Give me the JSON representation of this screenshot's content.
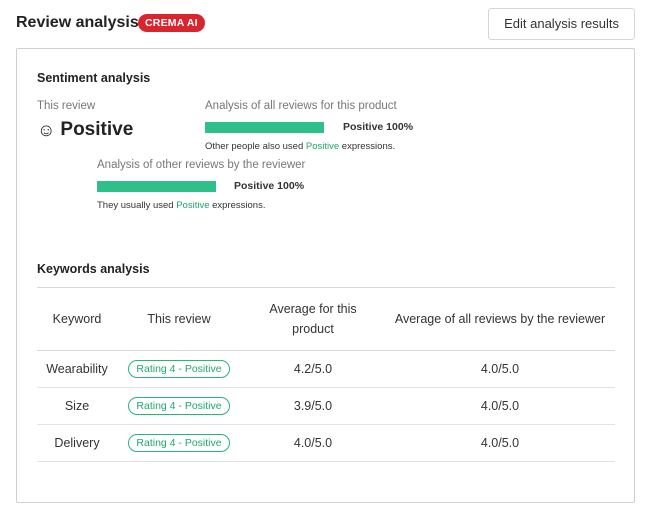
{
  "header": {
    "title": "Review analysis",
    "badge": "CREMA AI",
    "edit_button": "Edit analysis results"
  },
  "sentiment": {
    "section_title": "Sentiment analysis",
    "this_review_label": "This review",
    "this_review_value": "Positive",
    "product_label": "Analysis of all reviews for this product",
    "product_percent": "Positive 100%",
    "product_fill": 1.0,
    "product_note_prefix": "Other people also used ",
    "product_note_highlight": "Positive",
    "product_note_suffix": " expressions.",
    "reviewer_label": "Analysis of other reviews by the reviewer",
    "reviewer_percent": "Positive 100%",
    "reviewer_fill": 1.0,
    "reviewer_note_prefix": "They usually used ",
    "reviewer_note_highlight": "Positive",
    "reviewer_note_suffix": " expressions.",
    "colors": {
      "bar": "#2ebf8a",
      "highlight": "#1fa86b"
    }
  },
  "keywords": {
    "section_title": "Keywords analysis",
    "headers": [
      "Keyword",
      "This review",
      "Average for this product",
      "Average of all reviews by the reviewer"
    ],
    "rows": [
      {
        "keyword": "Wearability",
        "rating": "Rating 4 - Positive",
        "product_avg": "4.2/5.0",
        "reviewer_avg": "4.0/5.0"
      },
      {
        "keyword": "Size",
        "rating": "Rating 4 - Positive",
        "product_avg": "3.9/5.0",
        "reviewer_avg": "4.0/5.0"
      },
      {
        "keyword": "Delivery",
        "rating": "Rating 4 - Positive",
        "product_avg": "4.0/5.0",
        "reviewer_avg": "4.0/5.0"
      }
    ]
  }
}
